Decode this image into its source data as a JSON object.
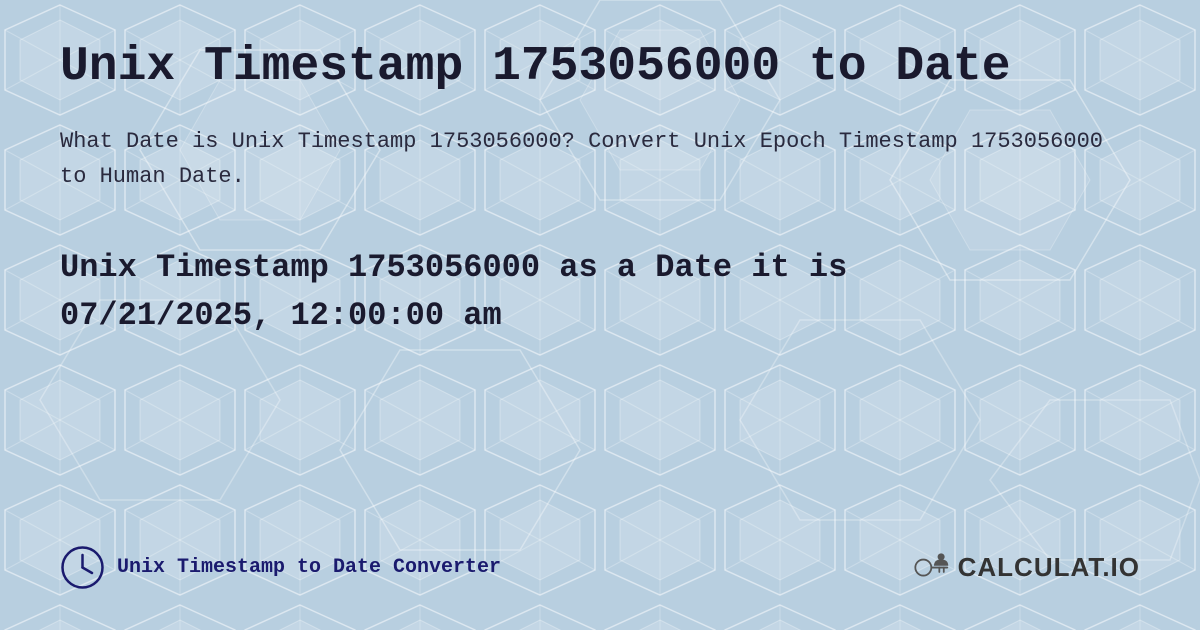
{
  "page": {
    "background_color": "#c8d8e8",
    "title": "Unix Timestamp 1753056000 to Date",
    "description": "What Date is Unix Timestamp 1753056000? Convert Unix Epoch Timestamp 1753056000 to Human Date.",
    "result": "Unix Timestamp 1753056000 as a Date it is 07/21/2025, 12:00:00 am",
    "result_line1": "Unix Timestamp 1753056000 as a Date it is",
    "result_line2": "07/21/2025, 12:00:00 am"
  },
  "footer": {
    "converter_label": "Unix Timestamp to Date Converter",
    "logo_text": "CALCULAT.IO"
  }
}
